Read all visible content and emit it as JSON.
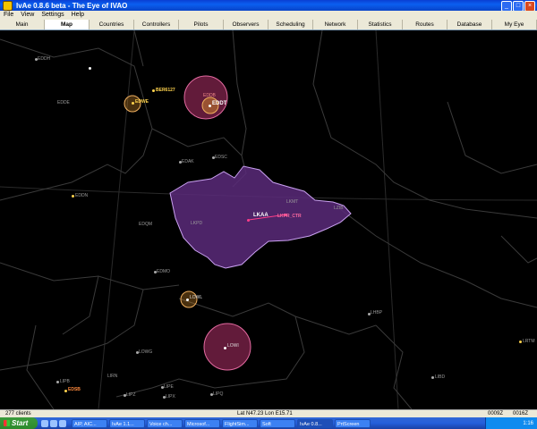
{
  "window": {
    "title": "IvAe 0.8.6 beta - The Eye of IVAO"
  },
  "menu": [
    "File",
    "View",
    "Settings",
    "Help"
  ],
  "tabs": [
    {
      "label": "Main",
      "active": false
    },
    {
      "label": "Map",
      "active": true
    },
    {
      "label": "Countries",
      "active": false
    },
    {
      "label": "Controllers",
      "active": false
    },
    {
      "label": "Pilots",
      "active": false
    },
    {
      "label": "Observers",
      "active": false
    },
    {
      "label": "Scheduling",
      "active": false
    },
    {
      "label": "Network",
      "active": false
    },
    {
      "label": "Statistics",
      "active": false
    },
    {
      "label": "Routes",
      "active": false
    },
    {
      "label": "Database",
      "active": false
    },
    {
      "label": "My Eye",
      "active": false
    }
  ],
  "map": {
    "labels": {
      "eddh": "EDDH",
      "edwe": "EDWE",
      "bre": "BER6127",
      "eddb": "EDDB",
      "eddt": "EDDT",
      "edde": "EDDE",
      "edsc": "EDSC",
      "edak": "EDAK",
      "eddn": "EDDN",
      "lkaa": "LKAA",
      "lkaa_ctr": "LKPR_CTR",
      "lkpd": "LKPD",
      "lkmt": "LKMT",
      "edqm": "EDQM",
      "edmo": "EDMO",
      "lowi": "LOWI",
      "lzib": "LZIB",
      "lowl": "LOWL",
      "lowg": "LOWG",
      "lipb": "LIPB",
      "lipz": "LIPZ",
      "lipe": "LIPE",
      "lipx": "LIPX",
      "lipq": "LIPQ",
      "libd": "LIBD",
      "lhbp": "LHBP",
      "lrtm": "LRTM",
      "edsb": "EDSB",
      "lirn": "LIRN"
    },
    "colors": {
      "fir": "#5a2a7a",
      "fir_edge": "#c9a0f0",
      "circle_pink": "#b3326a",
      "circle_orange": "#d08a2a"
    }
  },
  "status": {
    "clients": "277 clients",
    "coords": "Lat N47.23 Lon E15.71",
    "time1": "0009Z",
    "time2": "0016Z"
  },
  "taskbar": {
    "start": "Start",
    "tasks": [
      "AIP, AIC...",
      "IvAe 1.1...",
      "Voice ch...",
      "Microsof...",
      "FlightSim...",
      "Soft",
      "IvAe 0.8...",
      "PrtScreen"
    ],
    "clock": "1:16"
  }
}
